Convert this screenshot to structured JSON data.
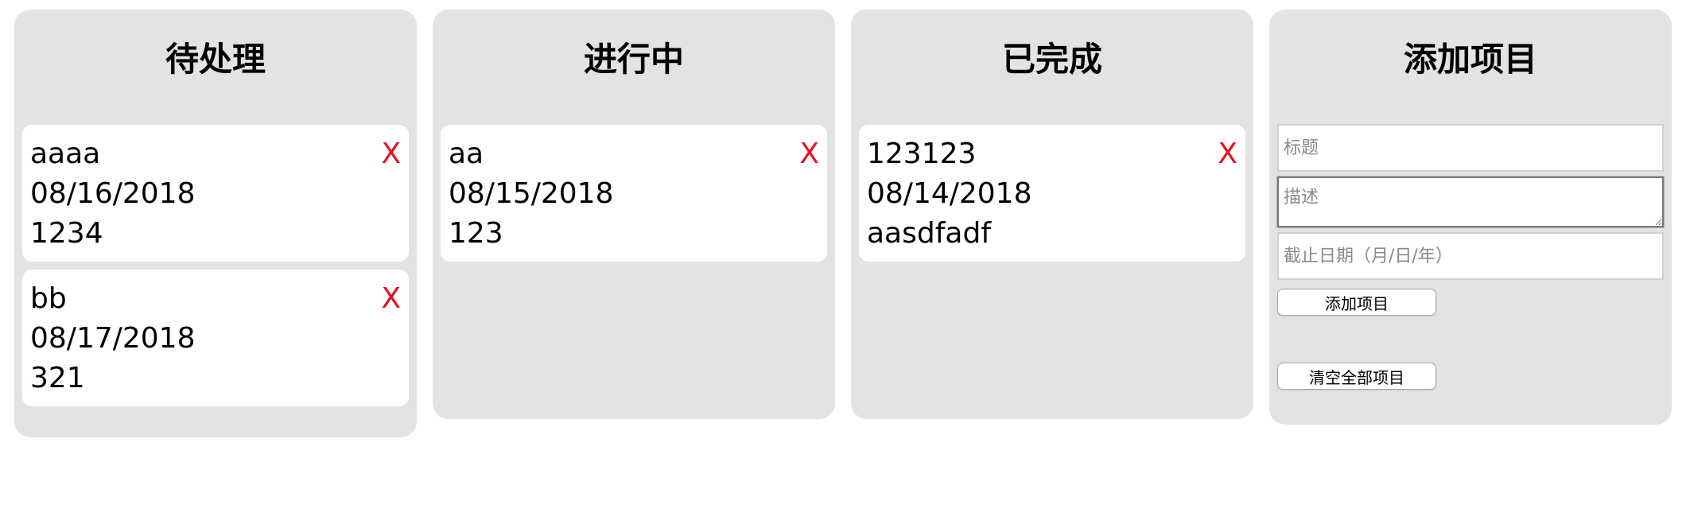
{
  "columns": [
    {
      "title": "待处理",
      "cards": [
        {
          "title": "aaaa",
          "date": "08/16/2018",
          "description": "1234",
          "delete": "X"
        },
        {
          "title": "bb",
          "date": "08/17/2018",
          "description": "321",
          "delete": "X"
        }
      ]
    },
    {
      "title": "进行中",
      "cards": [
        {
          "title": "aa",
          "date": "08/15/2018",
          "description": "123",
          "delete": "X"
        }
      ]
    },
    {
      "title": "已完成",
      "cards": [
        {
          "title": "123123",
          "date": "08/14/2018",
          "description": "aasdfadf",
          "delete": "X"
        }
      ]
    }
  ],
  "add_panel": {
    "title": "添加项目",
    "title_placeholder": "标题",
    "description_placeholder": "描述",
    "date_placeholder": "截止日期（月/日/年）",
    "add_button": "添加项目",
    "clear_button": "清空全部项目"
  },
  "colors": {
    "column_background": "#e3e3e3",
    "card_background": "#ffffff",
    "delete_red": "#e8101e"
  }
}
